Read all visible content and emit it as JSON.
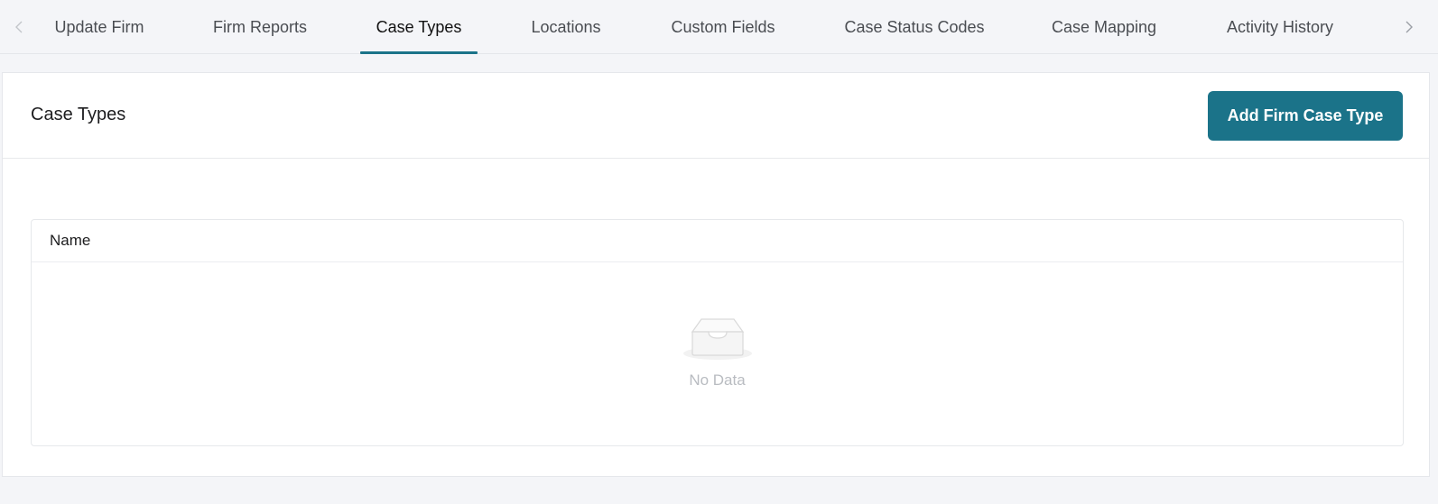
{
  "tabs": {
    "items": [
      {
        "label": "Update Firm",
        "active": false
      },
      {
        "label": "Firm Reports",
        "active": false
      },
      {
        "label": "Case Types",
        "active": true
      },
      {
        "label": "Locations",
        "active": false
      },
      {
        "label": "Custom Fields",
        "active": false
      },
      {
        "label": "Case Status Codes",
        "active": false
      },
      {
        "label": "Case Mapping",
        "active": false
      },
      {
        "label": "Activity History",
        "active": false
      }
    ],
    "prev_icon": "chevron-left-icon",
    "next_icon": "chevron-right-icon"
  },
  "section": {
    "title": "Case Types",
    "add_button_label": "Add Firm Case Type"
  },
  "table": {
    "columns": [
      "Name"
    ],
    "rows": [],
    "empty_icon": "empty-inbox-icon",
    "empty_text": "No Data"
  },
  "colors": {
    "accent": "#1b7389",
    "page_background": "#f4f5f8",
    "muted_text": "#b9bcc1"
  }
}
